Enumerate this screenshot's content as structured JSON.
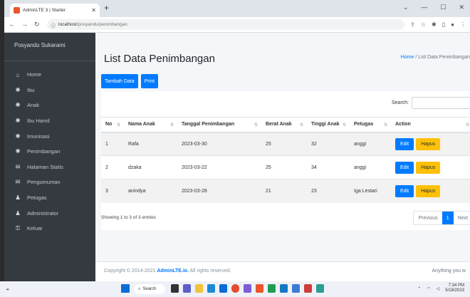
{
  "browser": {
    "tab_title": "AdminLTE 3 | Starter",
    "url_host": "localhost",
    "url_path": "/posyandu/penimbangan"
  },
  "sidebar": {
    "brand": "Posyandu Sukarami",
    "items": [
      {
        "label": "Home",
        "icon": "home-icon"
      },
      {
        "label": "Ibu",
        "icon": "gear-icon"
      },
      {
        "label": "Anak",
        "icon": "gear-icon"
      },
      {
        "label": "Ibu Hamil",
        "icon": "gear-icon"
      },
      {
        "label": "Imunisasi",
        "icon": "gear-icon"
      },
      {
        "label": "Penimbangan",
        "icon": "gear-icon"
      },
      {
        "label": "Halaman Statis",
        "icon": "envelope-icon"
      },
      {
        "label": "Pengumuman",
        "icon": "envelope-icon"
      },
      {
        "label": "Petugas",
        "icon": "user-icon"
      },
      {
        "label": "Administrator",
        "icon": "user-icon"
      },
      {
        "label": "Keluar",
        "icon": "key-icon"
      }
    ]
  },
  "page": {
    "title": "List Data Penimbangan",
    "breadcrumb_home": "Home",
    "breadcrumb_current": "List Data Penimbangan"
  },
  "actions": {
    "add": "Tambah Data",
    "print": "Print"
  },
  "search": {
    "label": "Search:"
  },
  "table": {
    "headers": [
      "No",
      "Nama Anak",
      "Tanggal Penimbangan",
      "Berat Anak",
      "Tinggi Anak",
      "Petugas",
      "Action"
    ],
    "rows": [
      {
        "no": "1",
        "nama": "Rafa",
        "tanggal": "2023-03-30",
        "berat": "25",
        "tinggi": "32",
        "petugas": "anggi"
      },
      {
        "no": "2",
        "nama": "dzaka",
        "tanggal": "2023-03-22",
        "berat": "25",
        "tinggi": "34",
        "petugas": "anggi"
      },
      {
        "no": "3",
        "nama": "anindya",
        "tanggal": "2023-03-28",
        "berat": "21",
        "tinggi": "23",
        "petugas": "Iga Lestari"
      }
    ],
    "edit": "Edit",
    "hapus": "Hapus"
  },
  "pagination": {
    "info": "Showing 1 to 3 of 3 entries",
    "prev": "Previous",
    "current": "1",
    "next": "Next"
  },
  "footer": {
    "copyright": "Copyright © 2014-2021 ",
    "brand": "AdminLTE.io.",
    "rights": " All rights reserved.",
    "right": "Anything you w"
  },
  "taskbar": {
    "search": "Search",
    "time": "7:34 PM",
    "date": "5/18/2023"
  }
}
